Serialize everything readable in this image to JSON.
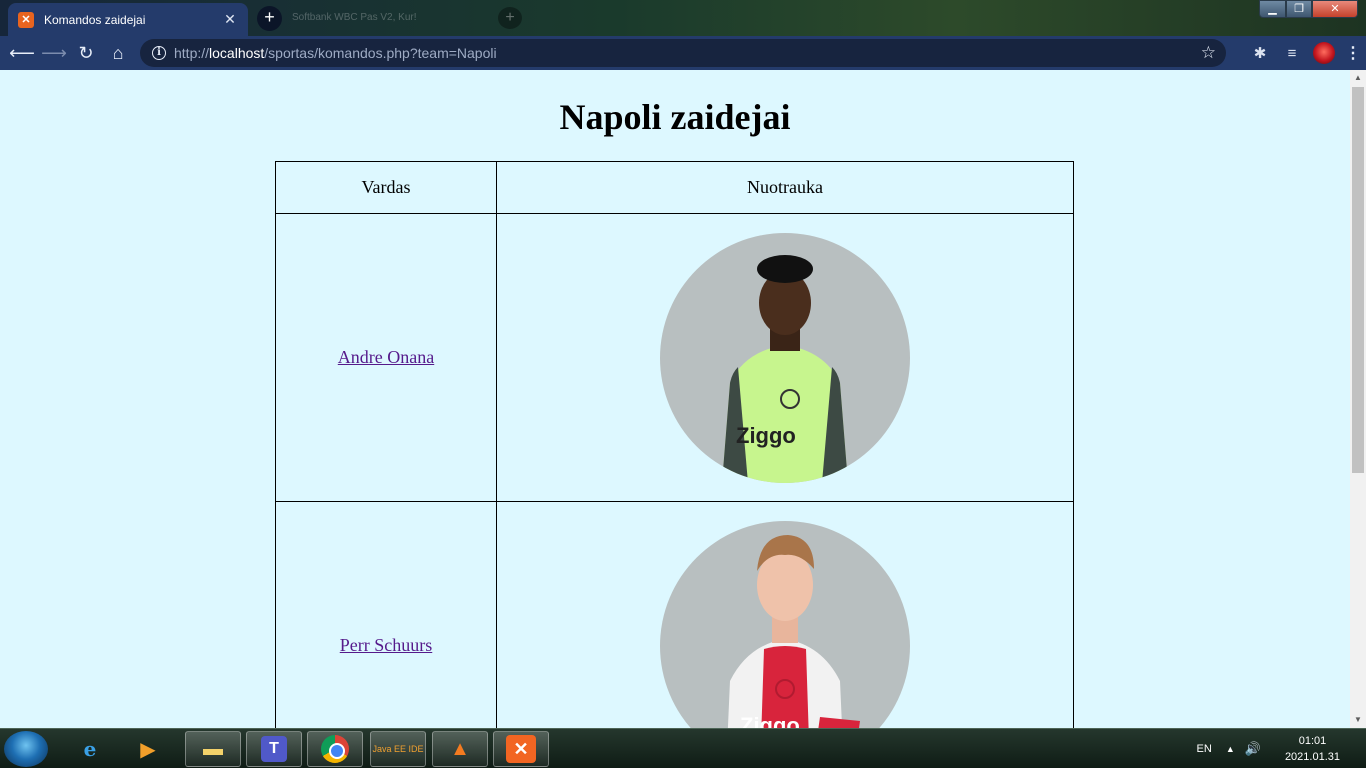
{
  "browser": {
    "tab_title": "Komandos zaidejai",
    "tab_favicon": "xampp-icon",
    "background_tab_title": "Softbank WBC Pas V2, Kur!",
    "url_scheme": "http://",
    "url_host": "localhost",
    "url_path": "/sportas/komandos.php?team=Napoli",
    "toolbar_icons": [
      "back-icon",
      "forward-icon",
      "reload-icon",
      "home-icon",
      "info-icon",
      "star-icon",
      "extensions-icon",
      "media-queue-icon",
      "profile-avatar",
      "menu-icon"
    ]
  },
  "page": {
    "title": "Napoli zaidejai",
    "table": {
      "headers": [
        "Vardas",
        "Nuotrauka"
      ],
      "rows": [
        {
          "name": "Andre Onana",
          "photo": "player-photo-goalkeeper-green-kit"
        },
        {
          "name": "Perr Schuurs",
          "photo": "player-photo-red-white-kit"
        }
      ]
    }
  },
  "taskbar": {
    "items": [
      "start-button",
      "internet-explorer",
      "windows-media-player",
      "file-explorer",
      "teams",
      "chrome",
      "java-ee-ide",
      "vlc",
      "xampp"
    ],
    "java_label": "Java EE IDE",
    "tray_language": "EN",
    "clock_time": "01:01",
    "clock_date": "2021.01.31"
  },
  "colors": {
    "page_background": "#ddf8ff",
    "chrome_toolbar": "#243b6b",
    "link": "#551a8b",
    "photo_background": "#b8bfc0"
  }
}
